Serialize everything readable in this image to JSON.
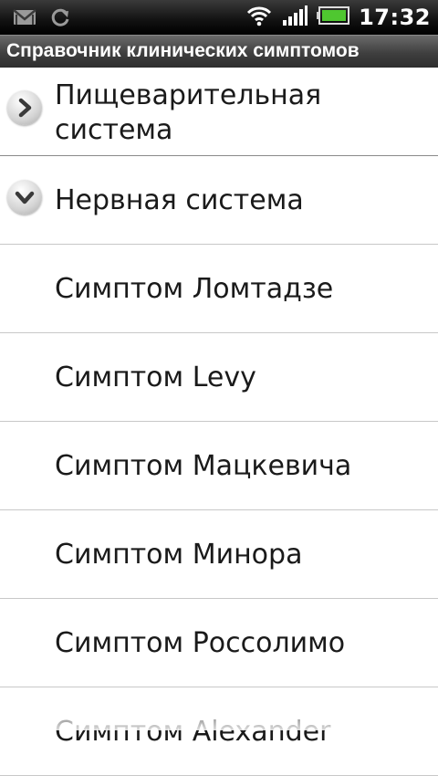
{
  "status_bar": {
    "time": "17:32",
    "icons": [
      "gmail-icon",
      "sync-icon",
      "wifi-icon",
      "signal-icon",
      "battery-icon"
    ]
  },
  "app": {
    "title": "Справочник клинических симптомов"
  },
  "list": {
    "groups": [
      {
        "label": "Пищеварительная система",
        "label_lines": [
          "Пищеварительная",
          "система"
        ],
        "expanded": false,
        "icon": "chevron-right-icon"
      },
      {
        "label": "Нервная система",
        "expanded": true,
        "icon": "chevron-down-icon"
      }
    ],
    "items": [
      "Симптом Ломтадзе",
      "Симптом Levy",
      "Симптом Мацкевича",
      "Симптом Минора",
      "Симптом Россолимо",
      "Симптом Alexander"
    ]
  }
}
